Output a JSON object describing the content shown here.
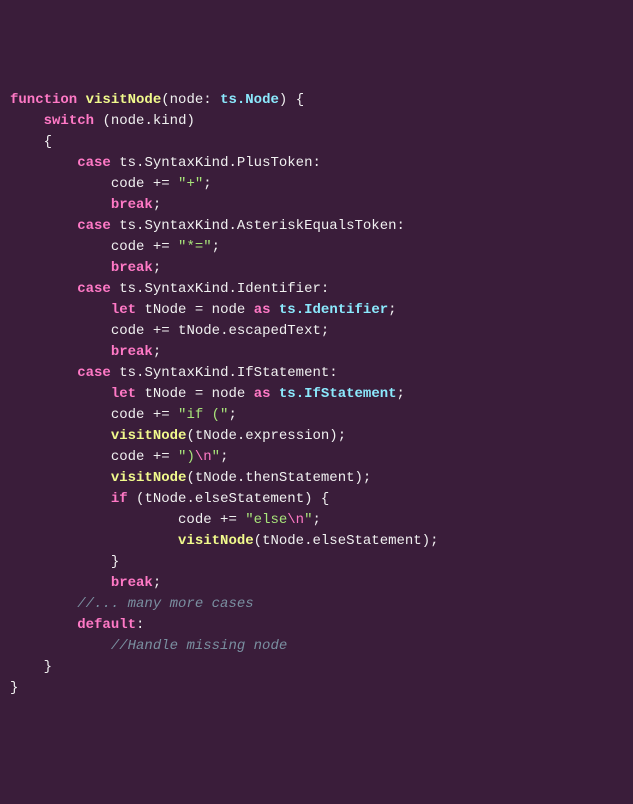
{
  "code": {
    "tokens": [
      {
        "t": "kw",
        "v": "function"
      },
      {
        "t": "plain",
        "v": " "
      },
      {
        "t": "fn",
        "v": "visitNode"
      },
      {
        "t": "punc",
        "v": "("
      },
      {
        "t": "plain",
        "v": "node"
      },
      {
        "t": "punc",
        "v": ": "
      },
      {
        "t": "type",
        "v": "ts.Node"
      },
      {
        "t": "punc",
        "v": ") {"
      },
      {
        "t": "nl"
      },
      {
        "t": "plain",
        "v": "    "
      },
      {
        "t": "kw",
        "v": "switch"
      },
      {
        "t": "plain",
        "v": " "
      },
      {
        "t": "punc",
        "v": "("
      },
      {
        "t": "plain",
        "v": "node"
      },
      {
        "t": "punc",
        "v": "."
      },
      {
        "t": "plain",
        "v": "kind"
      },
      {
        "t": "punc",
        "v": ")"
      },
      {
        "t": "nl"
      },
      {
        "t": "plain",
        "v": "    "
      },
      {
        "t": "punc",
        "v": "{"
      },
      {
        "t": "nl"
      },
      {
        "t": "plain",
        "v": "        "
      },
      {
        "t": "kw",
        "v": "case"
      },
      {
        "t": "plain",
        "v": " ts"
      },
      {
        "t": "punc",
        "v": "."
      },
      {
        "t": "plain",
        "v": "SyntaxKind"
      },
      {
        "t": "punc",
        "v": "."
      },
      {
        "t": "plain",
        "v": "PlusToken"
      },
      {
        "t": "punc",
        "v": ":"
      },
      {
        "t": "nl"
      },
      {
        "t": "plain",
        "v": "            code "
      },
      {
        "t": "punc",
        "v": "+= "
      },
      {
        "t": "str",
        "v": "\"+\""
      },
      {
        "t": "punc",
        "v": ";"
      },
      {
        "t": "nl"
      },
      {
        "t": "plain",
        "v": "            "
      },
      {
        "t": "kw",
        "v": "break"
      },
      {
        "t": "punc",
        "v": ";"
      },
      {
        "t": "nl"
      },
      {
        "t": "plain",
        "v": "        "
      },
      {
        "t": "kw",
        "v": "case"
      },
      {
        "t": "plain",
        "v": " ts"
      },
      {
        "t": "punc",
        "v": "."
      },
      {
        "t": "plain",
        "v": "SyntaxKind"
      },
      {
        "t": "punc",
        "v": "."
      },
      {
        "t": "plain",
        "v": "AsteriskEqualsToken"
      },
      {
        "t": "punc",
        "v": ":"
      },
      {
        "t": "nl"
      },
      {
        "t": "plain",
        "v": "            code "
      },
      {
        "t": "punc",
        "v": "+= "
      },
      {
        "t": "str",
        "v": "\"*=\""
      },
      {
        "t": "punc",
        "v": ";"
      },
      {
        "t": "nl"
      },
      {
        "t": "plain",
        "v": "            "
      },
      {
        "t": "kw",
        "v": "break"
      },
      {
        "t": "punc",
        "v": ";"
      },
      {
        "t": "nl"
      },
      {
        "t": "plain",
        "v": "        "
      },
      {
        "t": "kw",
        "v": "case"
      },
      {
        "t": "plain",
        "v": " ts"
      },
      {
        "t": "punc",
        "v": "."
      },
      {
        "t": "plain",
        "v": "SyntaxKind"
      },
      {
        "t": "punc",
        "v": "."
      },
      {
        "t": "plain",
        "v": "Identifier"
      },
      {
        "t": "punc",
        "v": ":"
      },
      {
        "t": "nl"
      },
      {
        "t": "plain",
        "v": "            "
      },
      {
        "t": "kw",
        "v": "let"
      },
      {
        "t": "plain",
        "v": " tNode "
      },
      {
        "t": "punc",
        "v": "= "
      },
      {
        "t": "plain",
        "v": "node "
      },
      {
        "t": "kw",
        "v": "as"
      },
      {
        "t": "plain",
        "v": " "
      },
      {
        "t": "type",
        "v": "ts.Identifier"
      },
      {
        "t": "punc",
        "v": ";"
      },
      {
        "t": "nl"
      },
      {
        "t": "plain",
        "v": "            code "
      },
      {
        "t": "punc",
        "v": "+= "
      },
      {
        "t": "plain",
        "v": "tNode"
      },
      {
        "t": "punc",
        "v": "."
      },
      {
        "t": "plain",
        "v": "escapedText"
      },
      {
        "t": "punc",
        "v": ";"
      },
      {
        "t": "nl"
      },
      {
        "t": "plain",
        "v": "            "
      },
      {
        "t": "kw",
        "v": "break"
      },
      {
        "t": "punc",
        "v": ";"
      },
      {
        "t": "nl"
      },
      {
        "t": "plain",
        "v": "        "
      },
      {
        "t": "kw",
        "v": "case"
      },
      {
        "t": "plain",
        "v": " ts"
      },
      {
        "t": "punc",
        "v": "."
      },
      {
        "t": "plain",
        "v": "SyntaxKind"
      },
      {
        "t": "punc",
        "v": "."
      },
      {
        "t": "plain",
        "v": "IfStatement"
      },
      {
        "t": "punc",
        "v": ":"
      },
      {
        "t": "nl"
      },
      {
        "t": "plain",
        "v": "            "
      },
      {
        "t": "kw",
        "v": "let"
      },
      {
        "t": "plain",
        "v": " tNode "
      },
      {
        "t": "punc",
        "v": "= "
      },
      {
        "t": "plain",
        "v": "node "
      },
      {
        "t": "kw",
        "v": "as"
      },
      {
        "t": "plain",
        "v": " "
      },
      {
        "t": "type",
        "v": "ts.IfStatement"
      },
      {
        "t": "punc",
        "v": ";"
      },
      {
        "t": "nl"
      },
      {
        "t": "plain",
        "v": "            code "
      },
      {
        "t": "punc",
        "v": "+= "
      },
      {
        "t": "str",
        "v": "\"if (\""
      },
      {
        "t": "punc",
        "v": ";"
      },
      {
        "t": "nl"
      },
      {
        "t": "plain",
        "v": "            "
      },
      {
        "t": "fn",
        "v": "visitNode"
      },
      {
        "t": "punc",
        "v": "("
      },
      {
        "t": "plain",
        "v": "tNode"
      },
      {
        "t": "punc",
        "v": "."
      },
      {
        "t": "plain",
        "v": "expression"
      },
      {
        "t": "punc",
        "v": ");"
      },
      {
        "t": "nl"
      },
      {
        "t": "plain",
        "v": "            code "
      },
      {
        "t": "punc",
        "v": "+= "
      },
      {
        "t": "str",
        "v": "\")"
      },
      {
        "t": "esc",
        "v": "\\n"
      },
      {
        "t": "str",
        "v": "\""
      },
      {
        "t": "punc",
        "v": ";"
      },
      {
        "t": "nl"
      },
      {
        "t": "plain",
        "v": "            "
      },
      {
        "t": "fn",
        "v": "visitNode"
      },
      {
        "t": "punc",
        "v": "("
      },
      {
        "t": "plain",
        "v": "tNode"
      },
      {
        "t": "punc",
        "v": "."
      },
      {
        "t": "plain",
        "v": "thenStatement"
      },
      {
        "t": "punc",
        "v": ");"
      },
      {
        "t": "nl"
      },
      {
        "t": "plain",
        "v": "            "
      },
      {
        "t": "kw",
        "v": "if"
      },
      {
        "t": "plain",
        "v": " "
      },
      {
        "t": "punc",
        "v": "("
      },
      {
        "t": "plain",
        "v": "tNode"
      },
      {
        "t": "punc",
        "v": "."
      },
      {
        "t": "plain",
        "v": "elseStatement"
      },
      {
        "t": "punc",
        "v": ") {"
      },
      {
        "t": "nl"
      },
      {
        "t": "plain",
        "v": "                    code "
      },
      {
        "t": "punc",
        "v": "+= "
      },
      {
        "t": "str",
        "v": "\"else"
      },
      {
        "t": "esc",
        "v": "\\n"
      },
      {
        "t": "str",
        "v": "\""
      },
      {
        "t": "punc",
        "v": ";"
      },
      {
        "t": "nl"
      },
      {
        "t": "plain",
        "v": "                    "
      },
      {
        "t": "fn",
        "v": "visitNode"
      },
      {
        "t": "punc",
        "v": "("
      },
      {
        "t": "plain",
        "v": "tNode"
      },
      {
        "t": "punc",
        "v": "."
      },
      {
        "t": "plain",
        "v": "elseStatement"
      },
      {
        "t": "punc",
        "v": ");"
      },
      {
        "t": "nl"
      },
      {
        "t": "plain",
        "v": "            "
      },
      {
        "t": "punc",
        "v": "}"
      },
      {
        "t": "nl"
      },
      {
        "t": "plain",
        "v": "            "
      },
      {
        "t": "kw",
        "v": "break"
      },
      {
        "t": "punc",
        "v": ";"
      },
      {
        "t": "nl"
      },
      {
        "t": "plain",
        "v": "        "
      },
      {
        "t": "comment",
        "v": "//... many more cases"
      },
      {
        "t": "nl"
      },
      {
        "t": "plain",
        "v": "        "
      },
      {
        "t": "kw",
        "v": "default"
      },
      {
        "t": "punc",
        "v": ":"
      },
      {
        "t": "nl"
      },
      {
        "t": "plain",
        "v": "            "
      },
      {
        "t": "comment",
        "v": "//Handle missing node"
      },
      {
        "t": "nl"
      },
      {
        "t": "plain",
        "v": "    "
      },
      {
        "t": "punc",
        "v": "}"
      },
      {
        "t": "nl"
      },
      {
        "t": "punc",
        "v": "}"
      }
    ]
  }
}
